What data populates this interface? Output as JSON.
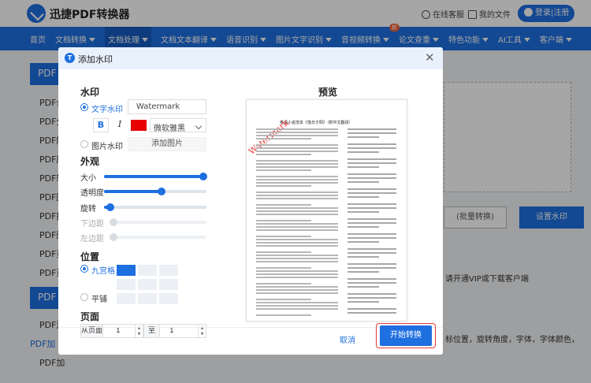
{
  "header": {
    "brand": "迅捷PDF转换器",
    "service_label": "在线客服",
    "files_label": "我的文件",
    "login_label": "登录|注册"
  },
  "nav": {
    "items": [
      "首页",
      "文档转换",
      "文档处理",
      "文档文本翻译",
      "语音识别",
      "图片文字识别",
      "音视频转换",
      "论文查重",
      "特色功能",
      "AI工具",
      "客户端"
    ],
    "new_badge": "新"
  },
  "background": {
    "side_head_1": "PDF",
    "side_head_2": "PDF",
    "side_items": [
      "PDF合",
      "PDF分",
      "PDF解",
      "PDF压",
      "PDF转",
      "PDF图",
      "PDF提",
      "PDF删",
      "PDF页",
      "PDF页",
      "PDF添",
      "PDF加",
      "PDF加"
    ],
    "btn_batch": "(批量转换)",
    "btn_set_wm": "设置水印",
    "note_vip": "请开通VIP或下载客户端",
    "note_settings": "标位置，旋转角度，字体，字体颜色，"
  },
  "modal": {
    "title": "添加水印",
    "section_watermark": "水印",
    "text_wm_label": "文字水印",
    "text_wm_value": "Watermark",
    "bold_label": "B",
    "italic_label": "I",
    "color": "#e60000",
    "font_value": "微软雅黑",
    "image_wm_label": "图片水印",
    "add_image_label": "添加图片",
    "section_appearance": "外观",
    "size_label": "大小",
    "size_level": 0.97,
    "opacity_label": "透明度",
    "opacity_level": 0.56,
    "rotation_label": "旋转",
    "rotation_level": 0.06,
    "bottom_margin_label": "下边距",
    "bottom_margin_level": 0.03,
    "left_margin_label": "左边距",
    "left_margin_level": 0.03,
    "section_position": "位置",
    "grid_label": "九宫格",
    "tile_label": "平铺",
    "selected_cell": "top-left",
    "section_pages": "页面",
    "from_label": "从页面",
    "from_value": "1",
    "to_label": "至",
    "to_value": "1",
    "preview_title": "预览",
    "preview_doc_title": "英语小说范本《落日夕阳》（附中文翻译）",
    "preview_watermark": "Watermark",
    "cancel_label": "取消",
    "start_label": "开始转换"
  },
  "colors": {
    "accent": "#1e6fe0",
    "highlight_ring": "#e53935"
  }
}
